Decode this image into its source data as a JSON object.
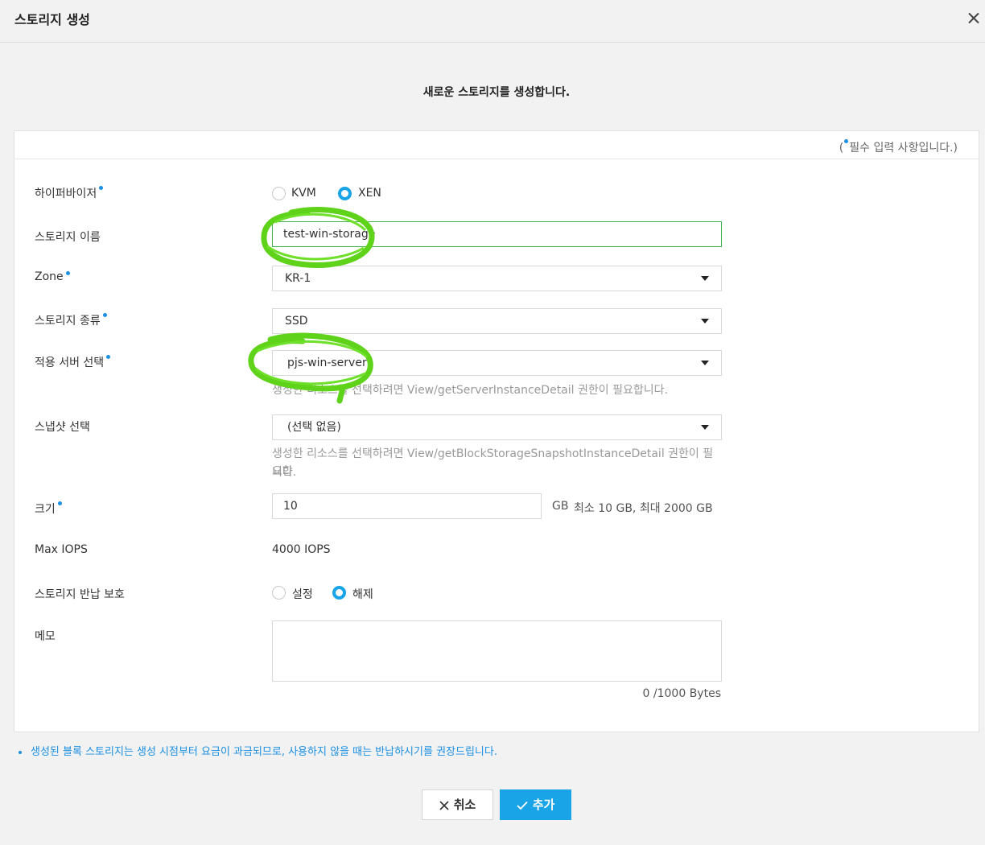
{
  "dialog": {
    "title": "스토리지 생성",
    "subtitle": "새로운 스토리지를 생성합니다."
  },
  "required_note": {
    "prefix": "(",
    "text": "필수 입력 사항입니다.)"
  },
  "form": {
    "hypervisor": {
      "label": "하이퍼바이저",
      "options": [
        "KVM",
        "XEN"
      ],
      "selected": "XEN"
    },
    "storage_name": {
      "label": "스토리지 이름",
      "value": "test-win-storage"
    },
    "zone": {
      "label": "Zone",
      "value": "KR-1"
    },
    "storage_type": {
      "label": "스토리지 종류",
      "value": "SSD"
    },
    "target_server": {
      "label": "적용 서버 선택",
      "value": "pjs-win-server",
      "help": "생성한 리소스를 선택하려면 View/getServerInstanceDetail 권한이 필요합니다."
    },
    "snapshot": {
      "label": "스냅샷 선택",
      "value": "(선택 없음)",
      "help_line1": "생성한 리소스를 선택하려면 View/getBlockStorageSnapshotInstanceDetail 권한이 필요합",
      "help_line2": "니다."
    },
    "size": {
      "label": "크기",
      "value": "10",
      "unit": "GB",
      "range": "최소 10 GB, 최대 2000 GB"
    },
    "max_iops": {
      "label": "Max IOPS",
      "value": "4000 IOPS"
    },
    "return_protection": {
      "label": "스토리지 반납 보호",
      "options": [
        "설정",
        "해제"
      ],
      "selected": "해제"
    },
    "memo": {
      "label": "메모",
      "value": "",
      "counter": "0 /1000 Bytes"
    }
  },
  "notice": "생성된 블록 스토리지는 생성 시점부터 요금이 과금되므로, 사용하지 않을 때는 반납하시기를 권장드립니다.",
  "buttons": {
    "cancel": "취소",
    "add": "추가"
  },
  "colors": {
    "accent": "#1aa4e8",
    "required_dot": "#1a8fe3",
    "annotation": "#5fd21a"
  },
  "icons": [
    "close-icon",
    "x-icon",
    "check-icon"
  ]
}
